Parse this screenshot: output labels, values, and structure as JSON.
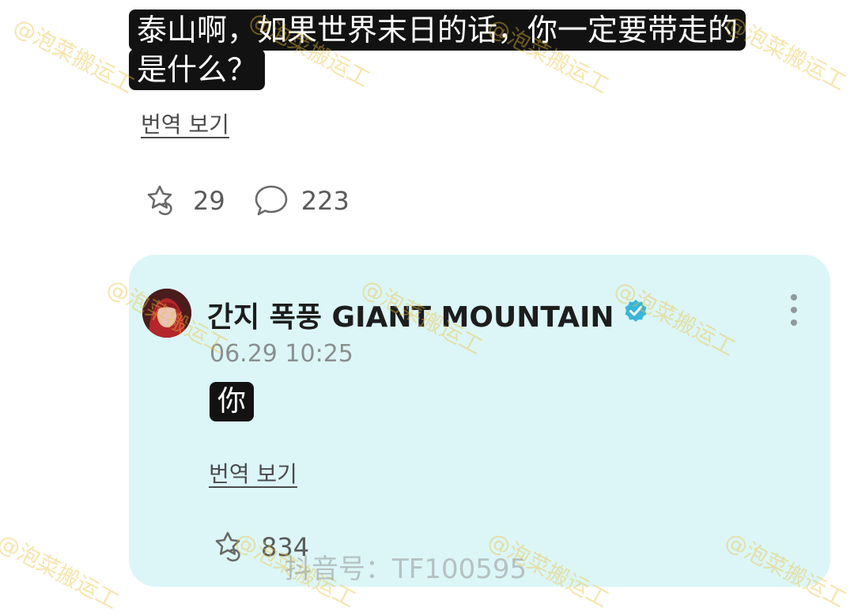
{
  "post": {
    "caption_line1": "泰山啊，如果世界末日的话，你一定要带走的",
    "caption_line2": "是什么？",
    "translate_label": "번역 보기",
    "like_count": "29",
    "comment_count": "223"
  },
  "reply": {
    "author": "간지 폭풍 GIANT MOUNTAIN",
    "timestamp": "06.29 10:25",
    "text": "你",
    "translate_label": "번역 보기",
    "like_count": "834"
  },
  "watermarks": {
    "text": "@泡菜搬运工",
    "bottom_text": "抖音号：TF100595"
  },
  "icons": {
    "like": "star-hand-icon",
    "comment": "speech-bubble-icon",
    "verified": "verified-badge-icon",
    "more": "more-vertical-icon"
  },
  "colors": {
    "card_background": "#dcf6f7",
    "caption_background": "#121212",
    "verified": "#39b6d9",
    "watermark": "#ebbe3c"
  }
}
